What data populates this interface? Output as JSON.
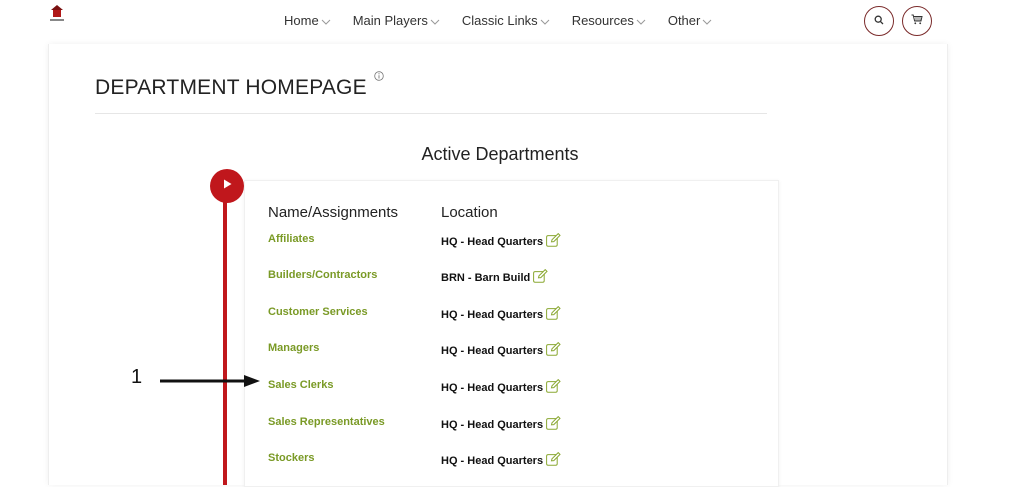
{
  "nav": {
    "items": [
      {
        "label": "Home"
      },
      {
        "label": "Main Players"
      },
      {
        "label": "Classic Links"
      },
      {
        "label": "Resources"
      },
      {
        "label": "Other"
      }
    ],
    "accent": "#7a2a2a"
  },
  "page": {
    "title": "DEPARTMENT HOMEPAGE"
  },
  "section": {
    "title": "Active Departments"
  },
  "table": {
    "headers": {
      "name": "Name/Assignments",
      "location": "Location"
    },
    "rows": [
      {
        "name": "Affiliates",
        "location": "HQ - Head Quarters"
      },
      {
        "name": "Builders/Contractors",
        "location": "BRN - Barn Build"
      },
      {
        "name": "Customer Services",
        "location": "HQ - Head Quarters"
      },
      {
        "name": "Managers",
        "location": "HQ - Head Quarters"
      },
      {
        "name": "Sales Clerks",
        "location": "HQ - Head Quarters"
      },
      {
        "name": "Sales Representatives",
        "location": "HQ - Head Quarters"
      },
      {
        "name": "Stockers",
        "location": "HQ - Head Quarters"
      }
    ],
    "name_color": "#7a9a26",
    "timeline_color": "#c0171c"
  },
  "annotation": {
    "number": "1"
  }
}
